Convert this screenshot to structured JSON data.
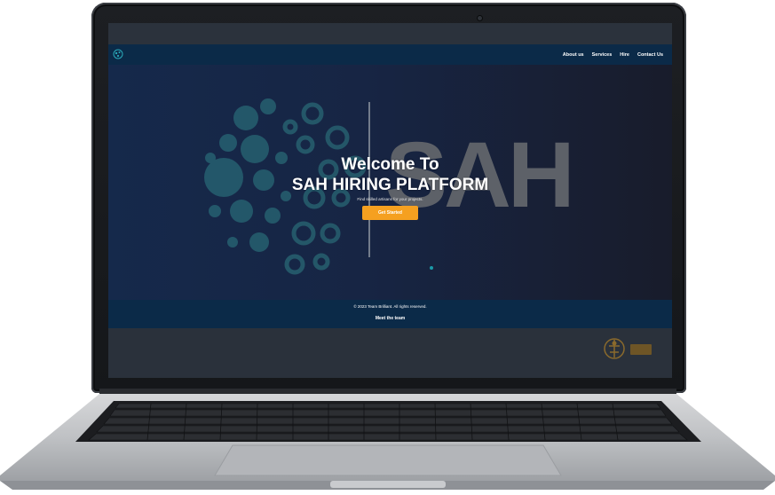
{
  "nav": {
    "links": [
      "About us",
      "Services",
      "Hire",
      "Contact Us"
    ]
  },
  "hero": {
    "title_line1": "Welcome To",
    "title_line2": "SAH HIRING PLATFORM",
    "subtitle": "Find skilled artisans for your projects.",
    "cta_label": "Get Started",
    "bg_text": "SAH"
  },
  "footer": {
    "copyright": "© 2023 Team Brilliant. All rights reserved.",
    "team_link": "Meet the team"
  },
  "colors": {
    "navbar": "#0b2a48",
    "cta": "#f5a020",
    "accent_teal": "#1b9aa8"
  }
}
